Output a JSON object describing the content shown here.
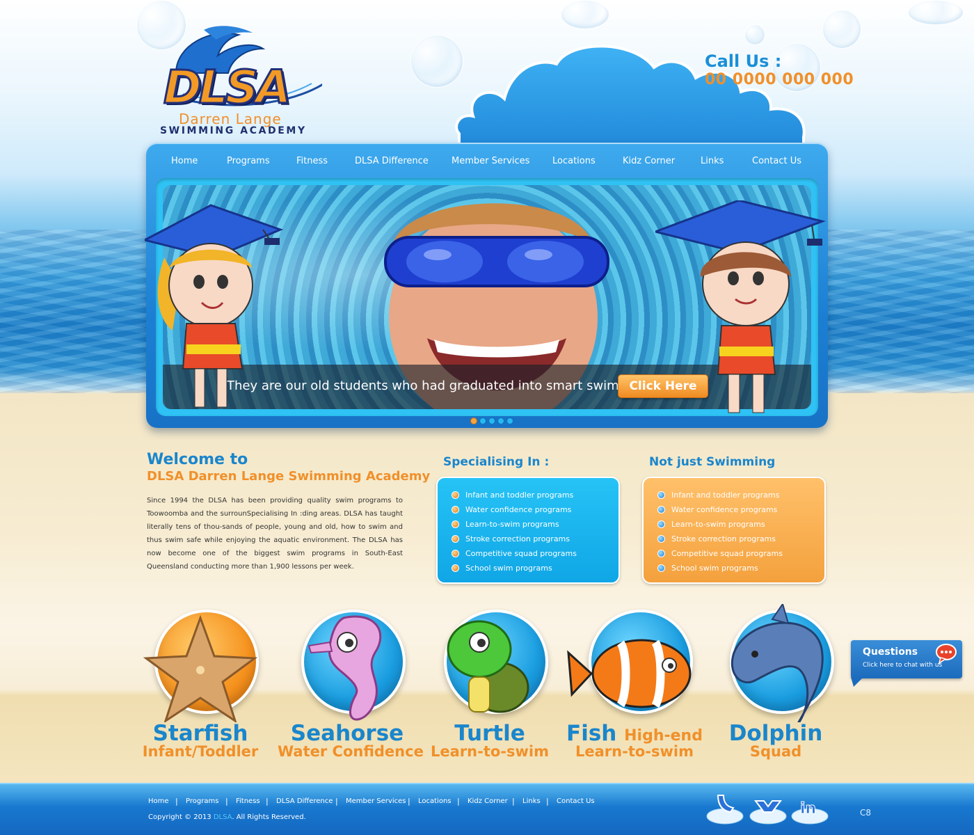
{
  "logo": {
    "word": "DLSA",
    "line1": "Darren Lange",
    "line2": "SWIMMING ACADEMY"
  },
  "call": {
    "label": "Call Us :",
    "number": "00 0000 000 000"
  },
  "nav": {
    "items": [
      "Home",
      "Programs",
      "Fitness",
      "DLSA Difference",
      "Member Services",
      "Locations",
      "Kidz Corner",
      "Links",
      "Contact Us"
    ]
  },
  "slider": {
    "caption": "They are our old students who had graduated into smart swimmers",
    "button": "Click Here",
    "slide_count": 5,
    "active_slide": 1
  },
  "welcome": {
    "title": "Welcome to",
    "subtitle": "DLSA Darren Lange Swimming Academy",
    "body": "Since 1994 the DLSA has been providing quality swim programs to Toowoomba and the surrounSpecialising In :ding areas. DLSA has taught literally tens of thou-sands of people, young and old, how to swim and thus swim safe while enjoying the aquatic environment. The DLSA has now become one of the biggest swim programs in South-East Queensland conducting more than 1,900 lessons per week."
  },
  "specialising": {
    "title": "Specialising In :",
    "items": [
      "Infant and toddler programs",
      "Water confidence programs",
      "Learn-to-swim programs",
      "Stroke correction programs",
      "Competitive squad programs",
      "School swim programs"
    ]
  },
  "not_just": {
    "title": "Not just Swimming",
    "items": [
      "Infant and toddler programs",
      "Water confidence programs",
      "Learn-to-swim programs",
      "Stroke correction programs",
      "Competitive squad programs",
      "School swim programs"
    ]
  },
  "levels": [
    {
      "name": "Starfish",
      "desc": "Infant/Toddler",
      "icon": "starfish-icon",
      "circle": "orange"
    },
    {
      "name": "Seahorse",
      "desc": "Water Confidence",
      "icon": "seahorse-icon",
      "circle": "blue"
    },
    {
      "name": "Turtle",
      "desc": "Learn-to-swim",
      "icon": "turtle-icon",
      "circle": "blue"
    },
    {
      "name": "Fish",
      "inline": "High-end",
      "desc": "Learn-to-swim",
      "icon": "clownfish-icon",
      "circle": "blue"
    },
    {
      "name": "Dolphin",
      "desc": "Squad",
      "icon": "dolphin-icon",
      "circle": "blue"
    }
  ],
  "chat": {
    "title": "Questions",
    "subtitle": "Click here to chat with us"
  },
  "footer": {
    "links": [
      "Home",
      "Programs",
      "Fitness",
      "DLSA Difference",
      "Member Services",
      "Locations",
      "Kidz Corner",
      "Links",
      "Contact Us"
    ],
    "copyright_prefix": "Copyright © 2013",
    "copyright_brand": "DLSA",
    "copyright_suffix": ". All Rights Reserved.",
    "social": [
      "twitter-icon",
      "yahoo-icon",
      "linkedin-icon"
    ],
    "version": "C8"
  },
  "colors": {
    "primary_blue": "#1a86cc",
    "accent_orange": "#f0902a",
    "nav_blue": "#1c7fd3",
    "sand": "#f4e5bf"
  }
}
